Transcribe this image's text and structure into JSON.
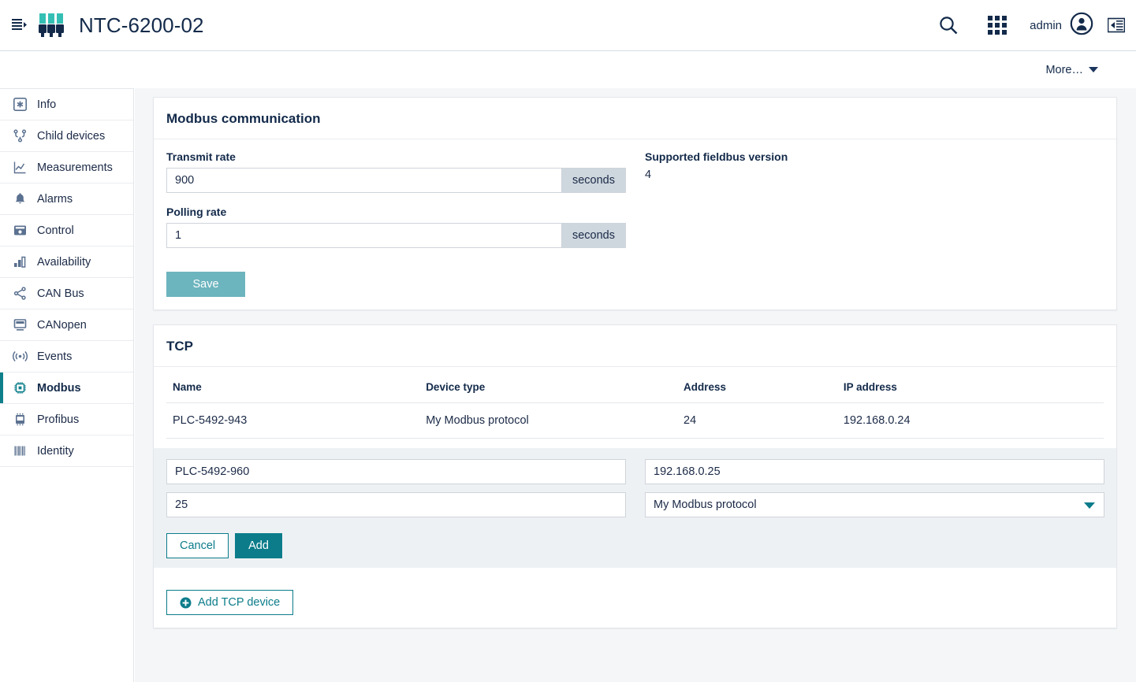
{
  "header": {
    "collapse_icon": "menu-collapse-icon",
    "logo_icon": "device-connectors-logo",
    "title": "NTC-6200-02",
    "search_icon": "search-icon",
    "apps_icon": "app-grid-icon",
    "user_name": "admin",
    "user_icon": "user-avatar-icon",
    "panel_icon": "right-panel-toggle-icon"
  },
  "subheader": {
    "more_label": "More…",
    "caret_icon": "chevron-down-icon"
  },
  "sidebar": {
    "items": [
      {
        "label": "Info",
        "icon": "info-asterisk-icon",
        "active": false
      },
      {
        "label": "Child devices",
        "icon": "hierarchy-icon",
        "active": false
      },
      {
        "label": "Measurements",
        "icon": "line-chart-icon",
        "active": false
      },
      {
        "label": "Alarms",
        "icon": "bell-icon",
        "active": false
      },
      {
        "label": "Control",
        "icon": "control-panel-icon",
        "active": false
      },
      {
        "label": "Availability",
        "icon": "bar-chart-icon",
        "active": false
      },
      {
        "label": "CAN Bus",
        "icon": "share-nodes-icon",
        "active": false
      },
      {
        "label": "CANopen",
        "icon": "monitor-icon",
        "active": false
      },
      {
        "label": "Events",
        "icon": "broadcast-icon",
        "active": false
      },
      {
        "label": "Modbus",
        "icon": "chip-icon",
        "active": true
      },
      {
        "label": "Profibus",
        "icon": "chip-square-icon",
        "active": false
      },
      {
        "label": "Identity",
        "icon": "barcode-icon",
        "active": false
      }
    ]
  },
  "modbus_card": {
    "title": "Modbus communication",
    "transmit_rate": {
      "label": "Transmit rate",
      "value": "900",
      "unit": "seconds"
    },
    "polling_rate": {
      "label": "Polling rate",
      "value": "1",
      "unit": "seconds"
    },
    "fieldbus_version": {
      "label": "Supported fieldbus version",
      "value": "4"
    },
    "save_label": "Save"
  },
  "tcp_card": {
    "title": "TCP",
    "columns": [
      "Name",
      "Device type",
      "Address",
      "IP address"
    ],
    "rows": [
      {
        "name": "PLC-5492-943",
        "device_type": "My Modbus protocol",
        "address": "24",
        "ip": "192.168.0.24"
      }
    ],
    "new_device": {
      "name_value": "PLC-5492-960",
      "ip_value": "192.168.0.25",
      "address_value": "25",
      "device_type_value": "My Modbus protocol",
      "device_type_options": [
        "My Modbus protocol"
      ],
      "cancel_label": "Cancel",
      "add_label": "Add",
      "caret_icon": "chevron-down-icon"
    },
    "add_tcp_label": "Add TCP device",
    "add_tcp_icon": "plus-circle-icon"
  },
  "colors": {
    "teal": "#0c7c8a",
    "teal_muted": "#6cb4be",
    "navy": "#132a4a",
    "page_bg": "#f4f6f8",
    "newrow_bg": "#eef1f4"
  }
}
